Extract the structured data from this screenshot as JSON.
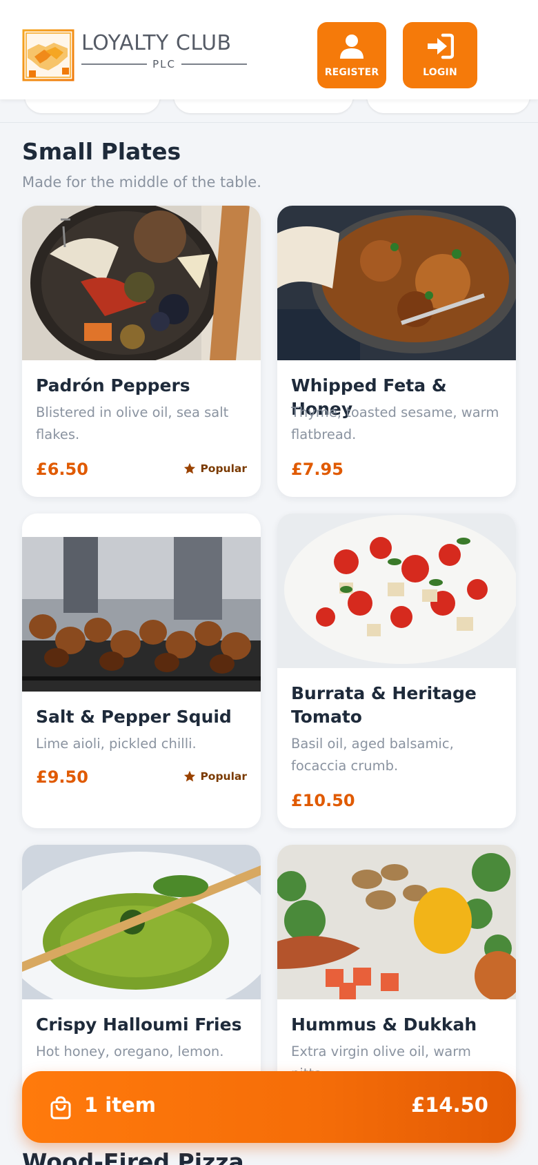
{
  "brand": {
    "name": "LOYALTY CLUB",
    "suffix": "PLC"
  },
  "header": {
    "register_label": "REGISTER",
    "login_label": "LOGIN",
    "accent": "#f57a0a"
  },
  "section": {
    "title": "Small Plates",
    "subtitle": "Made for the middle of the table."
  },
  "items": [
    {
      "title": "Padrón Peppers",
      "desc": "Blistered in olive oil, sea salt flakes.",
      "price": "£6.50",
      "badge": "Popular",
      "image": "charcuterie-board"
    },
    {
      "title": "Whipped Feta & Honey",
      "desc": "Thyme, toasted sesame, warm flatbread.",
      "price": "£7.95",
      "badge": "",
      "image": "curry-pan"
    },
    {
      "title": "Salt & Pepper Squid",
      "desc": "Lime aioli, pickled chilli.",
      "price": "£9.50",
      "badge": "Popular",
      "image": "grilled-skewers"
    },
    {
      "title": "Burrata & Heritage Tomato",
      "desc": "Basil oil, aged balsamic, focaccia crumb.",
      "price": "£10.50",
      "badge": "",
      "image": "tomato-salad"
    },
    {
      "title": "Crispy Halloumi Fries",
      "desc": "Hot honey, oregano, lemon.",
      "price": "",
      "badge": "",
      "image": "green-soup"
    },
    {
      "title": "Hummus & Dukkah",
      "desc": "Extra virgin olive oil, warm pitta.",
      "price": "",
      "badge": "",
      "image": "vegetables"
    }
  ],
  "cart": {
    "count_label": "1 item",
    "total": "£14.50"
  },
  "next_section": {
    "title": "Wood-Fired Pizza"
  },
  "colors": {
    "price": "#e05a00",
    "badge": "#7a3a00",
    "title": "#1e2a3a",
    "muted": "#8a93a0"
  }
}
